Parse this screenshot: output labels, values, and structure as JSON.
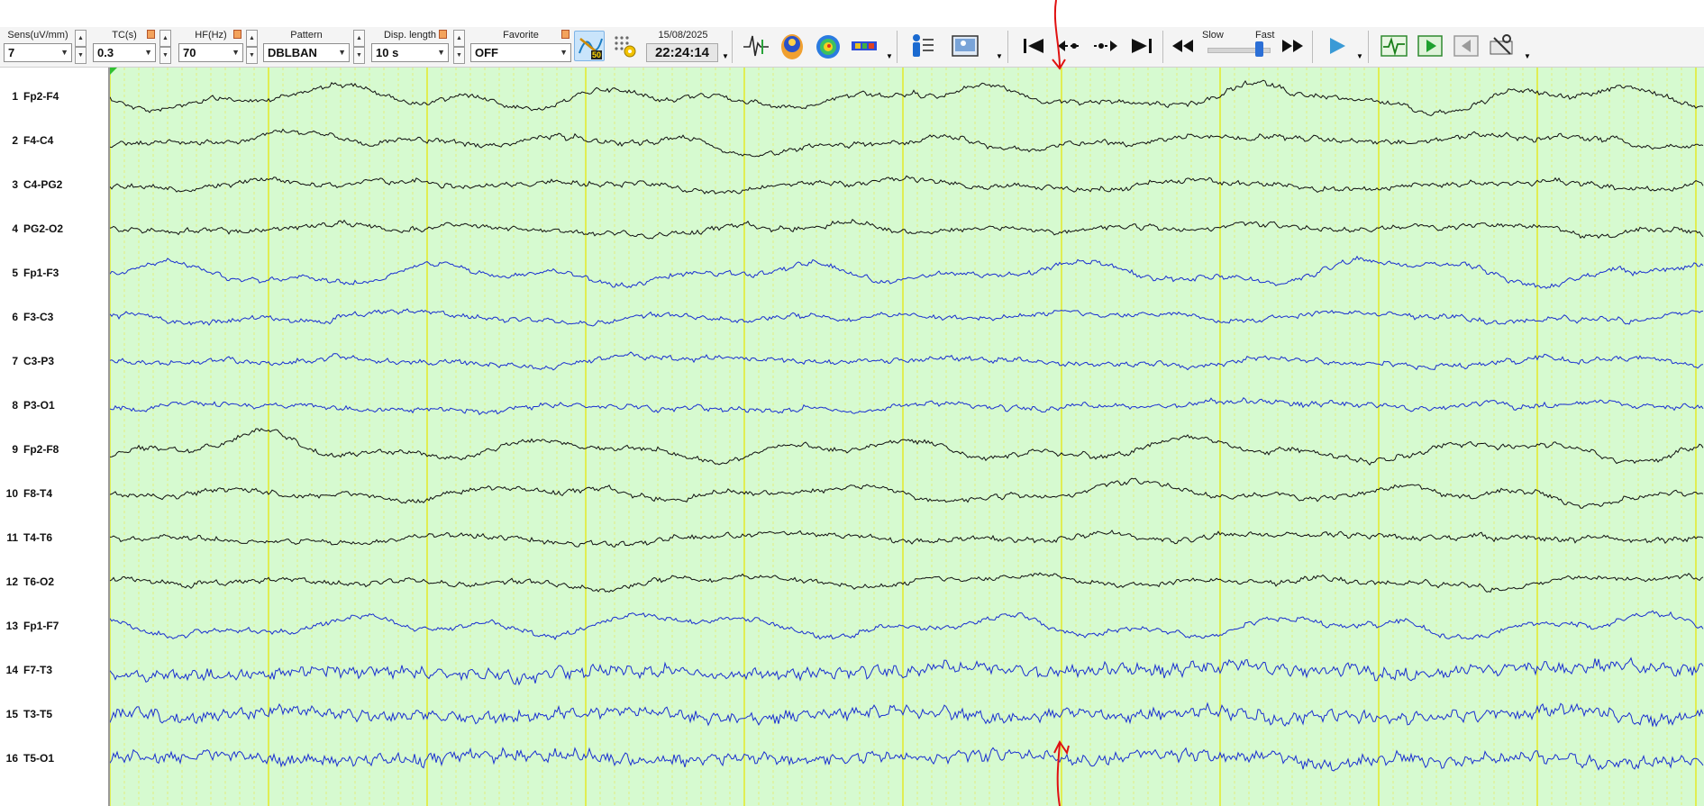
{
  "toolbar": {
    "sens": {
      "label": "Sens(uV/mm)",
      "value": "7"
    },
    "tc": {
      "label": "TC(s)",
      "value": "0.3"
    },
    "hf": {
      "label": "HF(Hz)",
      "value": "70"
    },
    "pattern": {
      "label": "Pattern",
      "value": "DBLBAN"
    },
    "disp_length": {
      "label": "Disp. length",
      "value": "10 s"
    },
    "favorite": {
      "label": "Favorite",
      "value": "OFF"
    },
    "notch_badge": "50",
    "date": "15/08/2025",
    "time": "22:24:14",
    "speed_slow": "Slow",
    "speed_fast": "Fast"
  },
  "icons": [
    "notch-filter-icon",
    "montage-settings-icon",
    "waveform-icon",
    "head-map-icon",
    "topo-map-icon",
    "spectrum-icon",
    "patient-info-icon",
    "video-icon",
    "go-start-icon",
    "prev-event-icon",
    "next-event-icon",
    "go-end-icon",
    "rewind-icon",
    "fast-forward-icon",
    "play-icon",
    "review-icon",
    "page-play-icon",
    "page-back-icon",
    "settings-tools-icon"
  ],
  "channels": [
    {
      "num": "1",
      "name": "Fp2-F4",
      "color": "#111111"
    },
    {
      "num": "2",
      "name": "F4-C4",
      "color": "#111111"
    },
    {
      "num": "3",
      "name": "C4-PG2",
      "color": "#111111"
    },
    {
      "num": "4",
      "name": "PG2-O2",
      "color": "#111111"
    },
    {
      "num": "5",
      "name": "Fp1-F3",
      "color": "#1a2fd0"
    },
    {
      "num": "6",
      "name": "F3-C3",
      "color": "#1a2fd0"
    },
    {
      "num": "7",
      "name": "C3-P3",
      "color": "#1a2fd0"
    },
    {
      "num": "8",
      "name": "P3-O1",
      "color": "#1a2fd0"
    },
    {
      "num": "9",
      "name": "Fp2-F8",
      "color": "#111111"
    },
    {
      "num": "10",
      "name": "F8-T4",
      "color": "#111111"
    },
    {
      "num": "11",
      "name": "T4-T6",
      "color": "#111111"
    },
    {
      "num": "12",
      "name": "T6-O2",
      "color": "#111111"
    },
    {
      "num": "13",
      "name": "Fp1-F7",
      "color": "#1a2fd0"
    },
    {
      "num": "14",
      "name": "F7-T3",
      "color": "#1a2fd0"
    },
    {
      "num": "15",
      "name": "T3-T5",
      "color": "#1a2fd0"
    },
    {
      "num": "16",
      "name": "T5-O1",
      "color": "#1a2fd0"
    }
  ],
  "colors": {
    "plot_background": "#d6fad0",
    "second_gridline": "#e6e600",
    "subsecond_gridline": "#e8e860",
    "annotation_red": "#e01010"
  }
}
